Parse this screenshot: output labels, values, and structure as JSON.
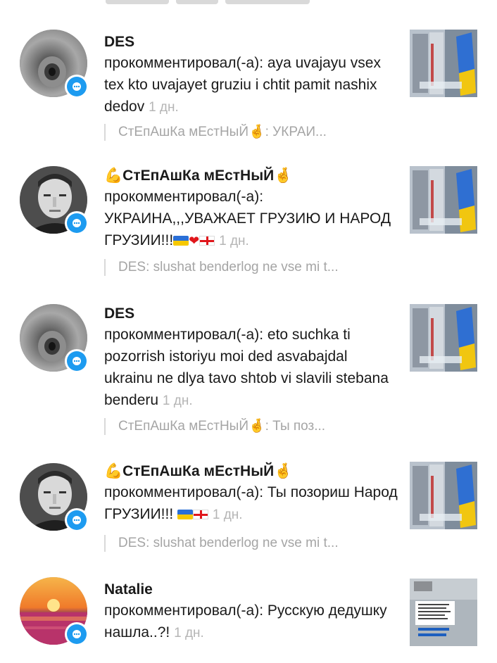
{
  "notifications": [
    {
      "user": "DES",
      "action": "прокомментировал(-а):",
      "comment": "aya uvajayu vsex tex kto uvajayet gruziu i chtit pamit nashix dedov",
      "time": "1 дн.",
      "reply_preview": "СтЕпАшКа мЕстНыЙ🤞: УКРАИ...",
      "avatar": "tunnel-avatar",
      "thumbnail": "shop-flag-thumb"
    },
    {
      "user": "💪СтЕпАшКа мЕстНыЙ🤞",
      "action": "прокомментировал(-а):",
      "comment": "УКРАИНА,,,УВАЖАЕТ ГРУЗИЮ И НАРОД ГРУЗИИ!!!",
      "comment_emoji": "🇺🇦❤️🇬🇪",
      "time": "1 дн.",
      "reply_preview": "DES: slushat benderlog ne vse mi t...",
      "avatar": "portrait-avatar",
      "thumbnail": "shop-flag-thumb"
    },
    {
      "user": "DES",
      "action": "прокомментировал(-а):",
      "comment": "eto suchka ti pozorrish istoriyu moi ded asvabajdal ukrainu ne dlya tavo shtob vi slavili stebana benderu",
      "time": "1 дн.",
      "reply_preview": "СтЕпАшКа мЕстНыЙ🤞: Ты поз...",
      "avatar": "tunnel-avatar",
      "thumbnail": "shop-flag-thumb"
    },
    {
      "user": "💪СтЕпАшКа мЕстНыЙ🤞",
      "action": "прокомментировал(-а):",
      "comment": "Ты позориш Народ ГРУЗИИ!!!",
      "comment_emoji": "🇺🇦🇬🇪",
      "time": "1 дн.",
      "reply_preview": "DES: slushat benderlog ne vse mi t...",
      "avatar": "portrait-avatar",
      "thumbnail": "shop-flag-thumb"
    },
    {
      "user": "Natalie",
      "action": "прокомментировал(-а):",
      "comment": "Русскую дедушку нашла..?!",
      "time": "1 дн.",
      "avatar": "sunset-avatar",
      "thumbnail": "street-text-thumb"
    }
  ],
  "colors": {
    "badge": "#1d9bf0",
    "time_gray": "#b5b5b5",
    "reply_gray": "#a5a5a5",
    "ua_blue": "#2a6fd6",
    "ua_yellow": "#f6c800",
    "ge_red": "#e0161b"
  }
}
